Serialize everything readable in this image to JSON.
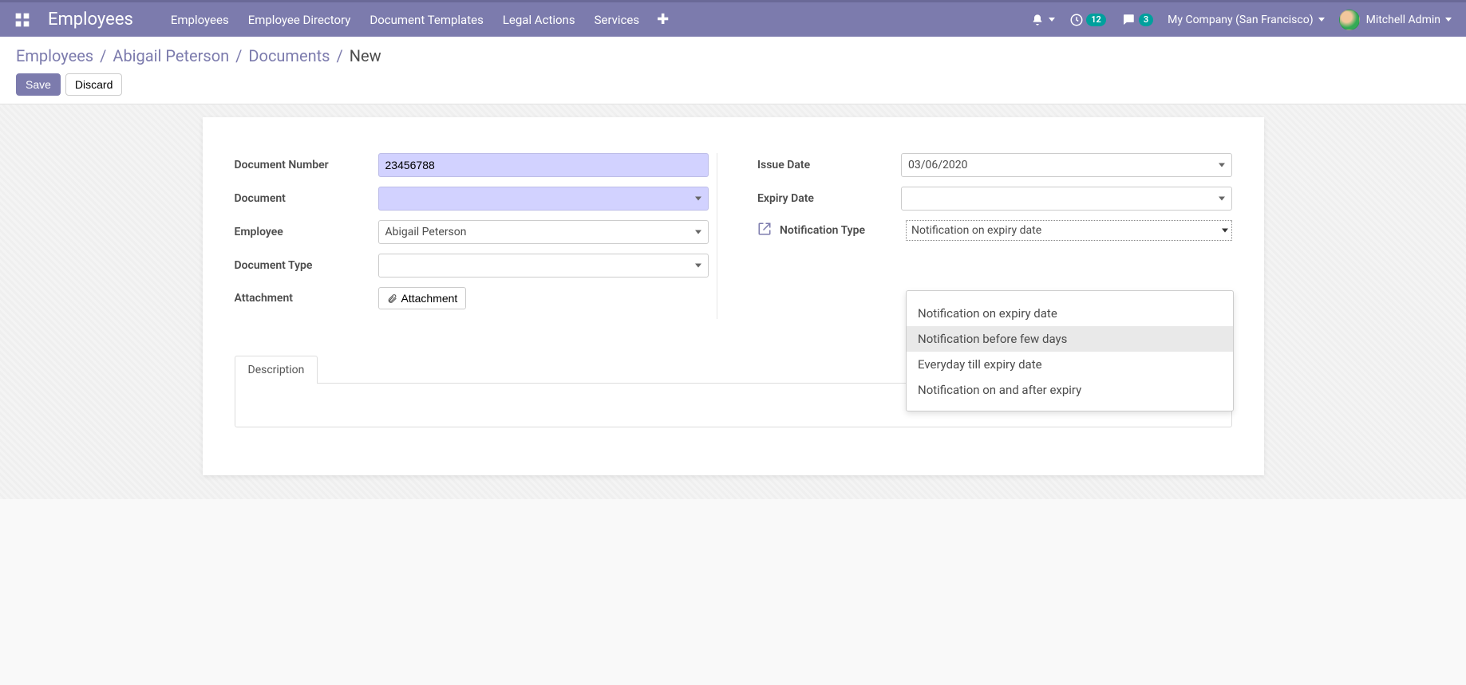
{
  "header": {
    "app_title": "Employees",
    "menu": [
      "Employees",
      "Employee Directory",
      "Document Templates",
      "Legal Actions",
      "Services"
    ],
    "activities_badge": "12",
    "messages_badge": "3",
    "company": "My Company (San Francisco)",
    "user": "Mitchell Admin"
  },
  "breadcrumbs": {
    "items": [
      "Employees",
      "Abigail Peterson",
      "Documents"
    ],
    "current": "New"
  },
  "buttons": {
    "save": "Save",
    "discard": "Discard"
  },
  "form": {
    "left": {
      "doc_number_label": "Document Number",
      "doc_number_value": "23456788",
      "document_label": "Document",
      "document_value": "",
      "employee_label": "Employee",
      "employee_value": "Abigail Peterson",
      "doc_type_label": "Document Type",
      "doc_type_value": "",
      "attachment_label": "Attachment",
      "attachment_btn": "Attachment"
    },
    "right": {
      "issue_date_label": "Issue Date",
      "issue_date_value": "03/06/2020",
      "expiry_date_label": "Expiry Date",
      "expiry_date_value": "",
      "notif_type_label": "Notification Type",
      "notif_type_value": "Notification on expiry date",
      "notif_options": [
        "Notification on expiry date",
        "Notification before few days",
        "Everyday till expiry date",
        "Notification on and after expiry"
      ]
    }
  },
  "tabs": {
    "description": "Description"
  }
}
